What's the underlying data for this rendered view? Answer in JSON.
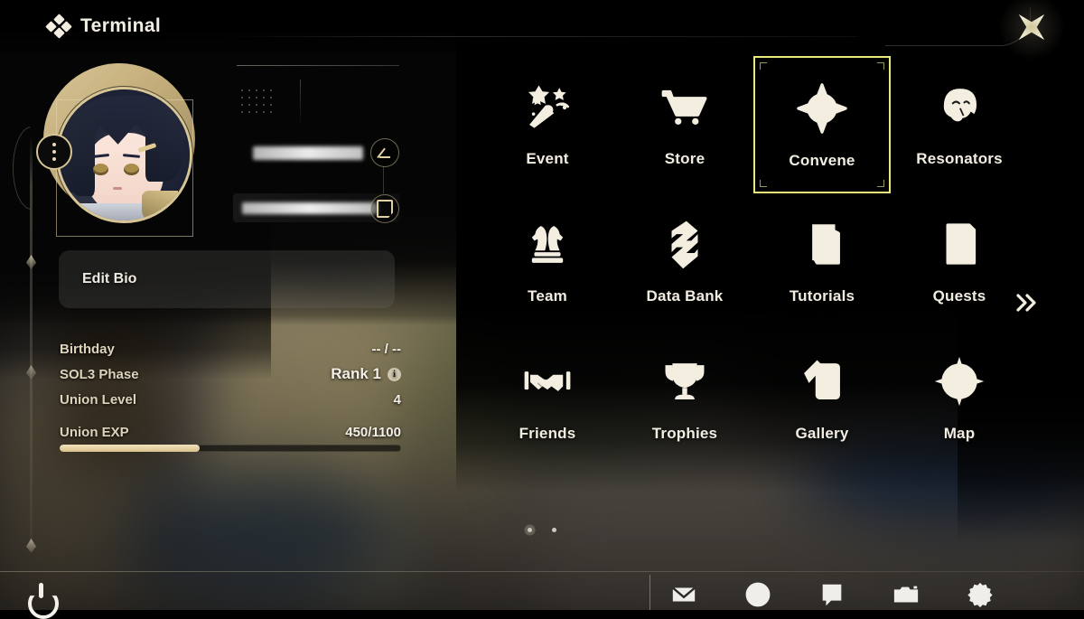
{
  "header": {
    "title": "Terminal",
    "logo_icon": "four-diamond-logo-icon",
    "close_icon": "close-star-icon"
  },
  "profile": {
    "avatar_icon": "character-avatar",
    "avatar_menu_icon": "more-options-dots-icon",
    "player_name": "",
    "player_name_redacted": true,
    "uid": "",
    "uid_redacted": true,
    "edit_name_icon": "pencil-edit-icon",
    "copy_uid_icon": "copy-icon",
    "edit_bio_label": "Edit Bio",
    "stats": [
      {
        "label": "Birthday",
        "value": "-- / --",
        "emphasis": false,
        "info": false
      },
      {
        "label": "SOL3 Phase",
        "value": "Rank 1",
        "emphasis": true,
        "info": true
      },
      {
        "label": "Union Level",
        "value": "4",
        "emphasis": true,
        "info": false
      }
    ],
    "exp": {
      "label": "Union EXP",
      "value_text": "450/1100",
      "current": 450,
      "max": 1100,
      "percent": 41,
      "fill_color": "#e4cf9e"
    }
  },
  "menu": {
    "selected": "Convene",
    "selection_color": "#e9e97e",
    "next_page_icon": "double-chevron-right-icon",
    "rows": [
      [
        {
          "label": "Event",
          "icon": "party-popper-icon",
          "selected": false
        },
        {
          "label": "Store",
          "icon": "shopping-cart-icon",
          "selected": false
        },
        {
          "label": "Convene",
          "icon": "compass-star-icon",
          "selected": true
        },
        {
          "label": "Resonators",
          "icon": "character-head-icon",
          "selected": false
        }
      ],
      [
        {
          "label": "Team",
          "icon": "chess-pieces-icon",
          "selected": false
        },
        {
          "label": "Data Bank",
          "icon": "layered-ribbon-icon",
          "selected": false
        },
        {
          "label": "Tutorials",
          "icon": "question-pages-icon",
          "selected": false
        },
        {
          "label": "Quests",
          "icon": "checklist-page-icon",
          "selected": false
        }
      ],
      [
        {
          "label": "Friends",
          "icon": "handshake-icon",
          "selected": false
        },
        {
          "label": "Trophies",
          "icon": "trophy-icon",
          "selected": false
        },
        {
          "label": "Gallery",
          "icon": "cards-icon",
          "selected": false
        },
        {
          "label": "Map",
          "icon": "compass-icon",
          "selected": false
        }
      ]
    ]
  },
  "pagination": {
    "total": 2,
    "active_index": 0
  },
  "bottom_bar": {
    "power_icon": "power-icon",
    "icons": [
      {
        "name": "mail-icon"
      },
      {
        "name": "clock-icon"
      },
      {
        "name": "chat-icon"
      },
      {
        "name": "camera-icon"
      },
      {
        "name": "settings-gear-icon"
      }
    ]
  }
}
